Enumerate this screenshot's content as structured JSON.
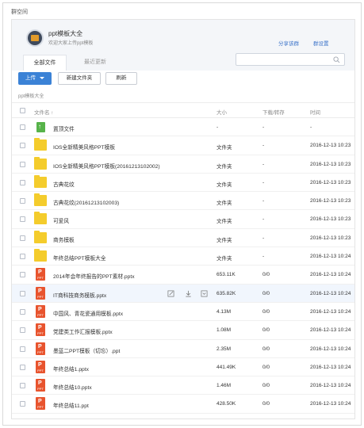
{
  "window_title": "群空间",
  "group": {
    "name": "ppt模板大全",
    "desc": "欢迎大家上传ppt模板",
    "share_label": "分享该群",
    "settings_label": "群设置"
  },
  "tabs": [
    "全部文件",
    "最近更新"
  ],
  "search": {
    "placeholder": ""
  },
  "toolbar": {
    "upload": "上传",
    "new_folder": "新建文件夹",
    "refresh": "刷新"
  },
  "breadcrumb": "ppt模板大全",
  "columns": {
    "name": "文件名 ↑",
    "size": "大小",
    "downloads": "下载/转存",
    "time": "时间"
  },
  "rows": [
    {
      "type": "top",
      "name": "置顶文件",
      "size": "-",
      "dl": "-",
      "time": "-"
    },
    {
      "type": "folder",
      "name": "IOS全新精美风格PPT模板",
      "size": "文件夹",
      "dl": "-",
      "time": "2016-12-13 10:23"
    },
    {
      "type": "folder",
      "name": "IOS全新精美风格PPT模板(20161213102002)",
      "size": "文件夹",
      "dl": "-",
      "time": "2016-12-13 10:23"
    },
    {
      "type": "folder",
      "name": "古典花纹",
      "size": "文件夹",
      "dl": "-",
      "time": "2016-12-13 10:23"
    },
    {
      "type": "folder",
      "name": "古典花纹(20161213102003)",
      "size": "文件夹",
      "dl": "-",
      "time": "2016-12-13 10:23"
    },
    {
      "type": "folder",
      "name": "可爱风",
      "size": "文件夹",
      "dl": "-",
      "time": "2016-12-13 10:23"
    },
    {
      "type": "folder",
      "name": "商务模板",
      "size": "文件夹",
      "dl": "-",
      "time": "2016-12-13 10:23"
    },
    {
      "type": "folder",
      "name": "年终总结PPT模板大全",
      "size": "文件夹",
      "dl": "-",
      "time": "2016-12-13 10:24"
    },
    {
      "type": "ppt",
      "name": "2014年会年终报告的PPT素材.pptx",
      "size": "653.11K",
      "dl": "0/0",
      "time": "2016-12-13 10:24"
    },
    {
      "type": "ppt",
      "name": "IT商科技商务模板.pptx",
      "size": "635.82K",
      "dl": "0/0",
      "time": "2016-12-13 10:24",
      "hover": true
    },
    {
      "type": "ppt",
      "name": "中国风、青花瓷通用模板.pptx",
      "size": "4.13M",
      "dl": "0/0",
      "time": "2016-12-13 10:24"
    },
    {
      "type": "ppt",
      "name": "党建类工作汇报模板.pptx",
      "size": "1.08M",
      "dl": "0/0",
      "time": "2016-12-13 10:24"
    },
    {
      "type": "ppt",
      "name": "墨蓝二PPT模板（切忘）.ppt",
      "size": "2.35M",
      "dl": "0/0",
      "time": "2016-12-13 10:24"
    },
    {
      "type": "ppt",
      "name": "年终总结1.pptx",
      "size": "441.49K",
      "dl": "0/0",
      "time": "2016-12-13 10:24"
    },
    {
      "type": "ppt",
      "name": "年终总结10.pptx",
      "size": "1.46M",
      "dl": "0/0",
      "time": "2016-12-13 10:24"
    },
    {
      "type": "ppt",
      "name": "年终总结11.ppt",
      "size": "428.50K",
      "dl": "0/0",
      "time": "2016-12-13 10:24"
    }
  ],
  "colors": {
    "accent": "#3b82d6",
    "folder": "#f4cc2c",
    "ppt": "#e8542e",
    "top": "#57b34a"
  }
}
